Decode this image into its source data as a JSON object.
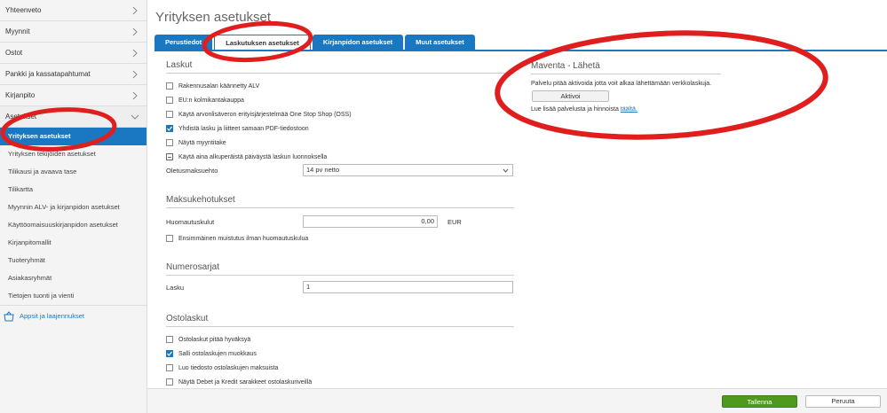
{
  "sidebar": {
    "top_items": [
      {
        "label": "Yhteenveto"
      },
      {
        "label": "Myynnit"
      },
      {
        "label": "Ostot"
      },
      {
        "label": "Pankki ja kassatapahtumat"
      },
      {
        "label": "Kirjanpito"
      },
      {
        "label": "Asetukset"
      }
    ],
    "sub_items": [
      {
        "label": "Yrityksen asetukset"
      },
      {
        "label": "Yrityksen tekijöiden asetukset"
      },
      {
        "label": "Tilikausi ja avaava tase"
      },
      {
        "label": "Tilikartta"
      },
      {
        "label": "Myynnin ALV- ja kirjanpidon asetukset"
      },
      {
        "label": "Käyttöomaisuuskirjanpidon asetukset"
      },
      {
        "label": "Kirjanpitomallit"
      },
      {
        "label": "Tuoteryhmät"
      },
      {
        "label": "Asiakasryhmät"
      },
      {
        "label": "Tietojen tuonti ja vienti"
      }
    ],
    "apps_label": "Appsit ja laajennukset"
  },
  "page": {
    "title": "Yrityksen asetukset"
  },
  "tabs": [
    {
      "label": "Perustiedot"
    },
    {
      "label": "Laskutuksen asetukset"
    },
    {
      "label": "Kirjanpidon asetukset"
    },
    {
      "label": "Muut asetukset"
    }
  ],
  "laskut": {
    "title": "Laskut",
    "checkboxes": [
      {
        "label": "Rakennusalan käännetty ALV",
        "checked": false
      },
      {
        "label": "EU:n kolmikantakauppa",
        "checked": false
      },
      {
        "label": "Käytä arvonlisäveron erityisjärjestelmää One Stop Shop (OSS)",
        "checked": false
      },
      {
        "label": "Yhdistä lasku ja liitteet samaan PDF-tiedostoon",
        "checked": true
      },
      {
        "label": "Näytä myyntitake",
        "checked": false
      },
      {
        "label": "Käytä aina alkuperäistä päiväystä laskun luonnoksella",
        "checked": false
      }
    ],
    "oletusmaksuehto_label": "Oletusmaksuehto",
    "oletusmaksuehto_value": "14 pv netto"
  },
  "maksukehotukset": {
    "title": "Maksukehotukset",
    "huomautuskulut_label": "Huomautuskulut",
    "huomautuskulut_value": "0,00",
    "currency": "EUR",
    "checkbox_label": "Ensimmäinen muistutus ilman huomautuskulua"
  },
  "numerosarjat": {
    "title": "Numerosarjat",
    "lasku_label": "Lasku",
    "lasku_value": "1"
  },
  "ostolaskut": {
    "title": "Ostolaskut",
    "checkboxes": [
      {
        "label": "Ostolaskut pitää hyväksyä",
        "checked": false
      },
      {
        "label": "Salli ostolaskujen muokkaus",
        "checked": true
      },
      {
        "label": "Luo tiedosto ostolaskujen maksuista",
        "checked": false
      },
      {
        "label": "Näytä Debet ja Kredit sarakkeet ostolaskuriveillä",
        "checked": false
      }
    ]
  },
  "maventa": {
    "title": "Maventa - Lähetä",
    "text": "Palvelu pitää aktivoida jotta voit alkaa lähettämään verkkolaskuja.",
    "button": "Aktivoi",
    "more_text": "Lue lisää palvelusta ja hinnoista",
    "more_link": "täältä."
  },
  "footer": {
    "save": "Tallenna",
    "cancel": "Peruuta"
  },
  "colors": {
    "accent": "#1a78c2",
    "save": "#4e9a1f",
    "annotation": "#e01e1e"
  }
}
